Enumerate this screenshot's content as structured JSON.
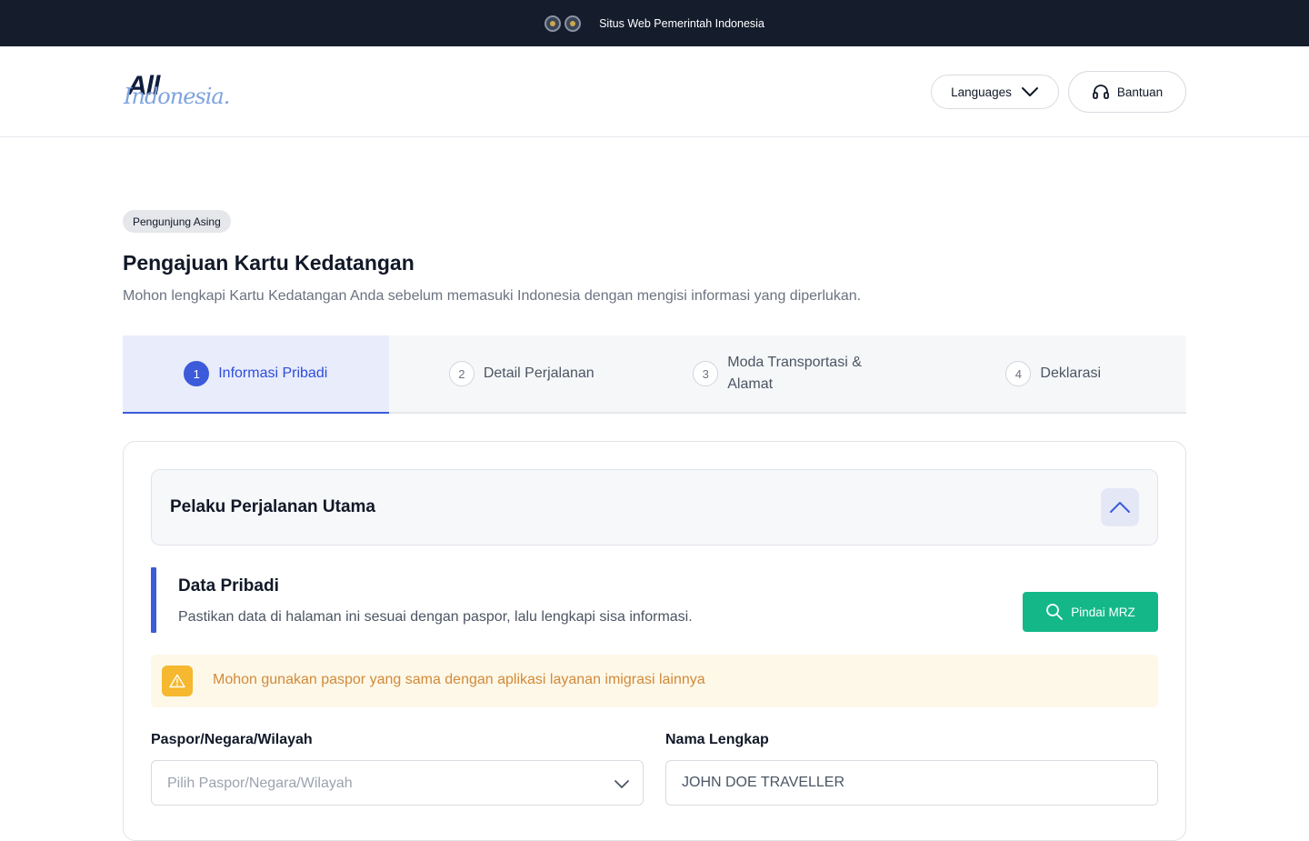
{
  "gov_banner": {
    "text": "Situs Web Pemerintah Indonesia",
    "emblems": [
      "garuda-emblem-icon",
      "immigration-emblem-icon"
    ]
  },
  "header": {
    "logo_line1": "All",
    "logo_line2": "Indonesia.",
    "languages_label": "Languages",
    "help_label": "Bantuan"
  },
  "page": {
    "badge": "Pengunjung Asing",
    "title": "Pengajuan Kartu Kedatangan",
    "subtitle": "Mohon lengkapi Kartu Kedatangan Anda sebelum memasuki Indonesia dengan mengisi informasi yang diperlukan."
  },
  "steps": [
    {
      "num": "1",
      "label": "Informasi Pribadi",
      "active": true
    },
    {
      "num": "2",
      "label": "Detail Perjalanan",
      "active": false
    },
    {
      "num": "3",
      "label": "Moda Transportasi & Alamat",
      "active": false
    },
    {
      "num": "4",
      "label": "Deklarasi",
      "active": false
    }
  ],
  "form": {
    "accordion_title": "Pelaku Perjalanan Utama",
    "section_title": "Data Pribadi",
    "section_subtitle": "Pastikan data di halaman ini sesuai dengan paspor, lalu lengkapi sisa informasi.",
    "scan_button": "Pindai MRZ",
    "alert_text": "Mohon gunakan paspor yang sama dengan aplikasi layanan imigrasi lainnya",
    "passport_label": "Paspor/Negara/Wilayah",
    "passport_placeholder": "Pilih Paspor/Negara/Wilayah",
    "name_label": "Nama Lengkap",
    "name_value": "JOHN DOE TRAVELLER"
  },
  "colors": {
    "primary": "#3b5bdb",
    "scan_button": "#14b888",
    "warning_bg": "#fdf8e8",
    "warning_icon": "#f5b82e",
    "warning_text": "#d28a3a",
    "top_banner": "#151c2c"
  }
}
